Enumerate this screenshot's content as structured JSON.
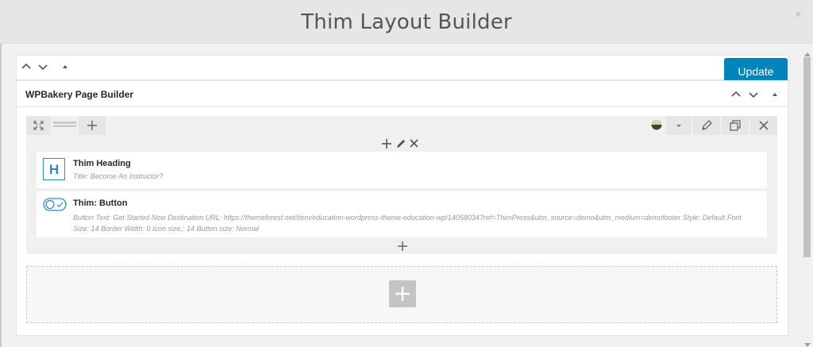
{
  "modal": {
    "title": "Thim Layout Builder",
    "close": "×"
  },
  "toolbar": {
    "update_label": "Update",
    "accent": "#0085ba"
  },
  "panel": {
    "title": "WPBakery Page Builder"
  },
  "row": {
    "column_controls": [
      "add-icon",
      "pencil-icon",
      "close-icon"
    ]
  },
  "elements": [
    {
      "icon": "heading-h-icon",
      "title": "Thim Heading",
      "description": "Title: Become An Instructor?"
    },
    {
      "icon": "toggle-button-icon",
      "title": "Thim: Button",
      "description": "Button Text: Get Started Now  Destination URL: https://themeforest.net/item/education-wordpress-theme-education-wp/14058034?ref=ThimPress&utm_source=demo&utm_medium=demofooter  Style: Default  Font Size: 14  Border Width: 0  Icon size.: 14  Button size: Normal"
    }
  ]
}
